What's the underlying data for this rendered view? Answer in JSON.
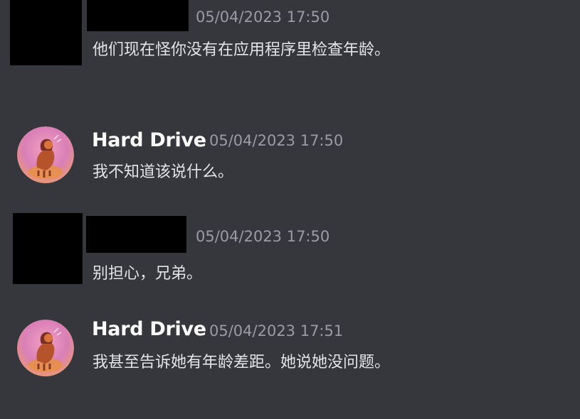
{
  "colors": {
    "background": "#36373d",
    "username": "#ffffff",
    "timestamp": "#9b9ca3",
    "message_text": "#e3e4e8",
    "redaction": "#000000"
  },
  "messages": [
    {
      "author": "",
      "author_redacted": true,
      "timestamp": "05/04/2023 17:50",
      "text": "他们现在怪你没有在应用程序里检查年龄。"
    },
    {
      "author": "Hard Drive",
      "author_redacted": false,
      "avatar_icon": "pony-avatar-icon",
      "timestamp": "05/04/2023 17:50",
      "text": "我不知道该说什么。"
    },
    {
      "author": "",
      "author_redacted": true,
      "timestamp": "05/04/2023 17:50",
      "text": "别担心，兄弟。"
    },
    {
      "author": "Hard Drive",
      "author_redacted": false,
      "avatar_icon": "pony-avatar-icon",
      "timestamp": "05/04/2023 17:51",
      "text": "我甚至告诉她有年龄差距。她说她没问题。"
    }
  ]
}
